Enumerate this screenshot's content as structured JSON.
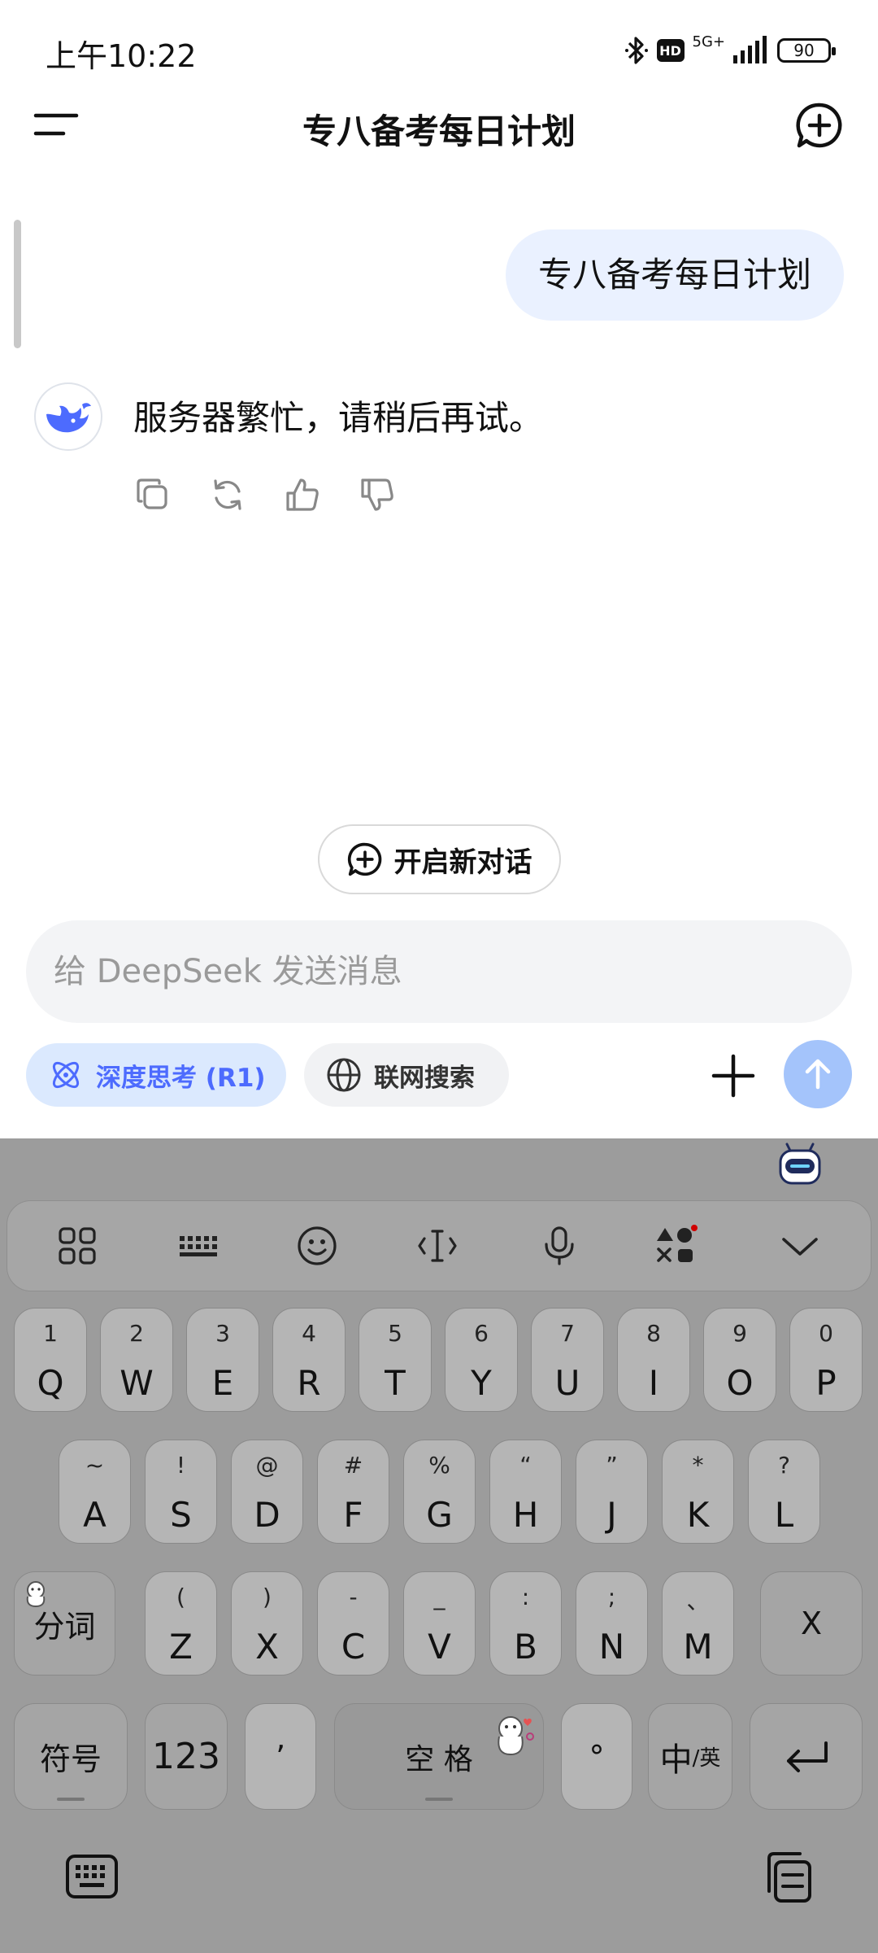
{
  "status_bar": {
    "time": "上午10:22",
    "hd_label": "HD",
    "network": "5G+",
    "battery": "90"
  },
  "header": {
    "title": "专八备考每日计划"
  },
  "chat": {
    "user_message": "专八备考每日计划",
    "ai_message": "服务器繁忙，请稍后再试。"
  },
  "new_dialog": {
    "label": "开启新对话"
  },
  "composer": {
    "placeholder": "给 DeepSeek 发送消息",
    "value": "",
    "deepthink_label": "深度思考 (R1)",
    "websearch_label": "联网搜索"
  },
  "colors": {
    "accent": "#4d6bfe",
    "send_disabled": "#a4c4fb",
    "bubble": "#eaf1ff",
    "keyboard_bg": "#9c9c9c"
  },
  "keyboard": {
    "row1": [
      {
        "sub": "1",
        "main": "Q"
      },
      {
        "sub": "2",
        "main": "W"
      },
      {
        "sub": "3",
        "main": "E"
      },
      {
        "sub": "4",
        "main": "R"
      },
      {
        "sub": "5",
        "main": "T"
      },
      {
        "sub": "6",
        "main": "Y"
      },
      {
        "sub": "7",
        "main": "U"
      },
      {
        "sub": "8",
        "main": "I"
      },
      {
        "sub": "9",
        "main": "O"
      },
      {
        "sub": "0",
        "main": "P"
      }
    ],
    "row2": [
      {
        "sub": "~",
        "main": "A"
      },
      {
        "sub": "!",
        "main": "S"
      },
      {
        "sub": "@",
        "main": "D"
      },
      {
        "sub": "#",
        "main": "F"
      },
      {
        "sub": "%",
        "main": "G"
      },
      {
        "sub": "“",
        "main": "H"
      },
      {
        "sub": "”",
        "main": "J"
      },
      {
        "sub": "*",
        "main": "K"
      },
      {
        "sub": "?",
        "main": "L"
      }
    ],
    "row3": [
      {
        "sub": "(",
        "main": "Z"
      },
      {
        "sub": ")",
        "main": "X"
      },
      {
        "sub": "-",
        "main": "C"
      },
      {
        "sub": "_",
        "main": "V"
      },
      {
        "sub": ":",
        "main": "B"
      },
      {
        "sub": ";",
        "main": "N"
      },
      {
        "sub": "、",
        "main": "M"
      }
    ],
    "segment_label": "分词",
    "delete_label": "X",
    "symbols_label": "符号",
    "numbers_label": "123",
    "apostrophe_label": "’",
    "space_label": "空 格",
    "period_label": "°",
    "lang_label_main": "中",
    "lang_label_sub": "/英"
  }
}
